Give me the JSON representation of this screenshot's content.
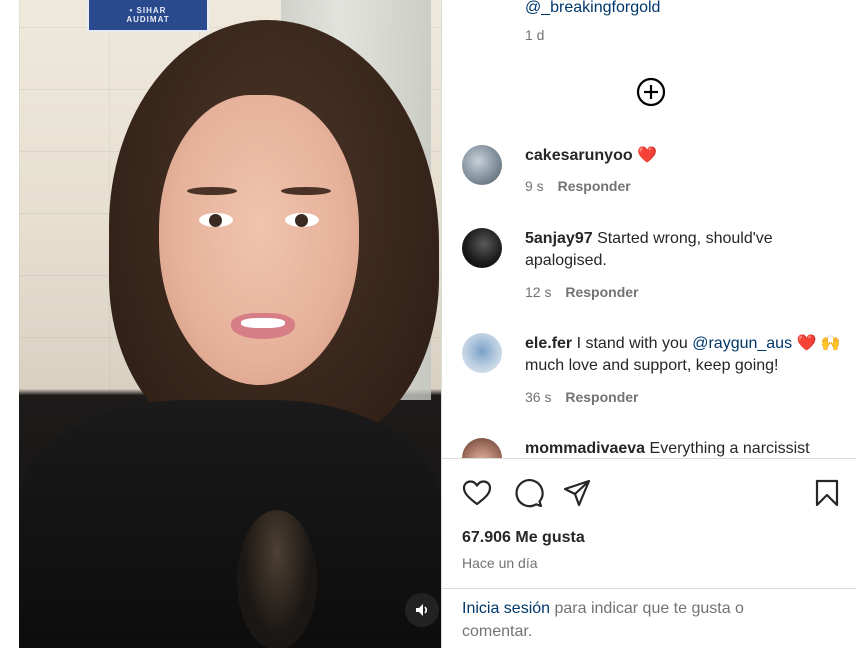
{
  "media": {
    "sign_line1": "• SIHAR",
    "sign_line2": "AUDIMAT",
    "mute_icon": "speaker-icon"
  },
  "caption": {
    "handle": "@_breakingforgold",
    "time": "1 d"
  },
  "load_more_icon": "plus-circle-icon",
  "comments": [
    {
      "username": "cakesarunyoo",
      "text": "",
      "mention": "",
      "emoji": "❤️",
      "time": "9 s",
      "reply": "Responder"
    },
    {
      "username": "5anjay97",
      "text": "Started wrong, should've apalogised.",
      "mention": "",
      "emoji": "",
      "time": "12 s",
      "reply": "Responder"
    },
    {
      "username": "ele.fer",
      "text": "I stand with you",
      "mention": "@raygun_aus",
      "emoji": "❤️",
      "text2": "🙌 much love and support, keep going!",
      "time": "36 s",
      "reply": "Responder"
    },
    {
      "username": "mommadivaeva",
      "text": "Everything a narcissist",
      "mention": "",
      "emoji": "",
      "time": "",
      "reply": ""
    }
  ],
  "actions": {
    "like_icon": "heart-icon",
    "comment_icon": "comment-icon",
    "share_icon": "share-icon",
    "save_icon": "bookmark-icon",
    "likes": "67.906 Me gusta",
    "post_time": "Hace un día"
  },
  "login": {
    "link": "Inicia sesión",
    "text": " para indicar que te gusta o comentar."
  },
  "colors": {
    "link": "#00376b",
    "muted": "#737373",
    "text": "#262626",
    "heart": "#ed1c24"
  }
}
